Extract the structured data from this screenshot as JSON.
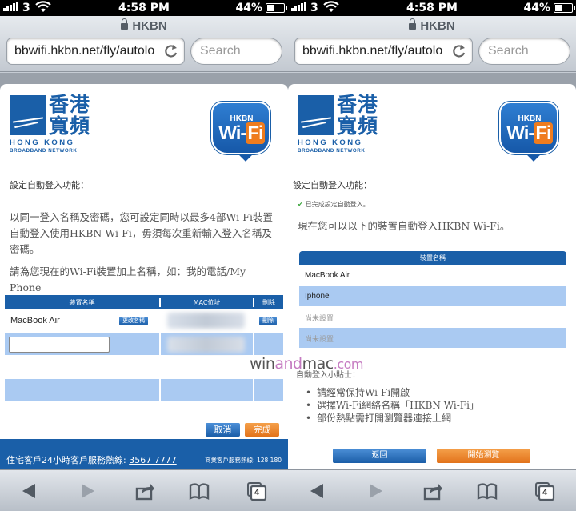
{
  "status": {
    "carrier": "3",
    "time": "4:58 PM",
    "battery": "44%",
    "battery_level": 0.44
  },
  "browser": {
    "page_title": "HKBN",
    "url": "bbwifi.hkbn.net/fly/autolo",
    "search_placeholder": "Search",
    "tabs_count": "4"
  },
  "brand": {
    "logo_chinese_line1": "香港",
    "logo_chinese_line2": "寬頻",
    "logo_english": "HONG KONG",
    "logo_english_sub": "BROADBAND NETWORK",
    "wifi_badge_top": "HKBN",
    "wifi_badge_main_a": "Wi-",
    "wifi_badge_main_b": "Fi"
  },
  "left": {
    "setup_label": "設定自動登入功能：",
    "intro": "以同一登入名稱及密碼，您可設定同時以最多4部Wi-Fi裝置自動登入使用HKBN Wi-Fi，毋須每次重新輸入登入名稱及密碼。",
    "prompt": "請為您現在的Wi-Fi裝置加上名稱，如：我的電話/My Phone",
    "table": {
      "headers": [
        "裝置名稱",
        "MAC位址",
        "刪除"
      ],
      "device_name": "MacBook Air",
      "rename_button": "更改名稱",
      "delete_button": "刪除"
    },
    "cancel_button": "取消",
    "done_button": "完成",
    "footer_text": "住宅客戶24小時客戶服務熱線:",
    "footer_phone": "3567 7777",
    "footer_business": "商業客戶服務熱線: 128 180"
  },
  "right": {
    "setup_label": "設定自動登入功能：",
    "done_message": "已完成設定自動登入。",
    "intro": "現在您可以以下的裝置自動登入HKBN Wi-Fi。",
    "table": {
      "header": "裝置名稱",
      "rows": [
        "MacBook Air",
        "Iphone",
        "尚未設置",
        "尚未設置"
      ]
    },
    "tips_title": "自動登入小貼士：",
    "tips": [
      "請經常保持Wi-Fi開啟",
      "選擇Wi-Fi網絡名稱「HKBN Wi-Fi」",
      "部份熱點需打開瀏覽器連接上網"
    ],
    "back_button": "返回",
    "browse_button": "開始瀏覽"
  },
  "watermark": {
    "part1": "win",
    "part2": "and",
    "part3": "mac",
    "part4": ".com"
  },
  "colors": {
    "brand_blue": "#1a5fa8",
    "row_blue": "#aacaf2",
    "accent_orange": "#e2731b"
  }
}
